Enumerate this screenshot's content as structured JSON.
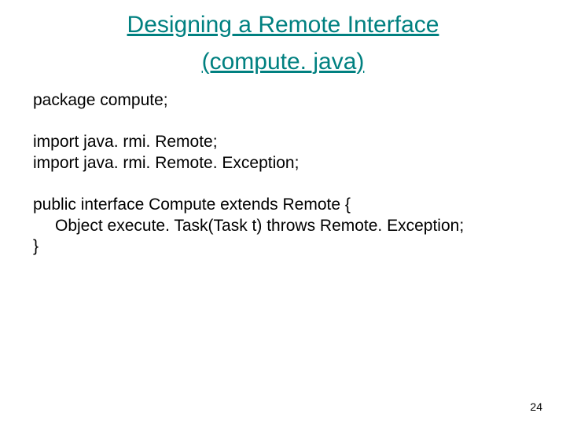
{
  "heading": {
    "line1": "Designing a Remote Interface",
    "line2": "(compute. java)"
  },
  "code": {
    "package_line": "package compute;",
    "import1": "import java. rmi. Remote;",
    "import2": "import java. rmi. Remote. Exception;",
    "public_line": "public interface Compute extends Remote {",
    "method_line": "Object execute. Task(Task t) throws Remote. Exception;",
    "close_brace": "}"
  },
  "page_number": "24"
}
